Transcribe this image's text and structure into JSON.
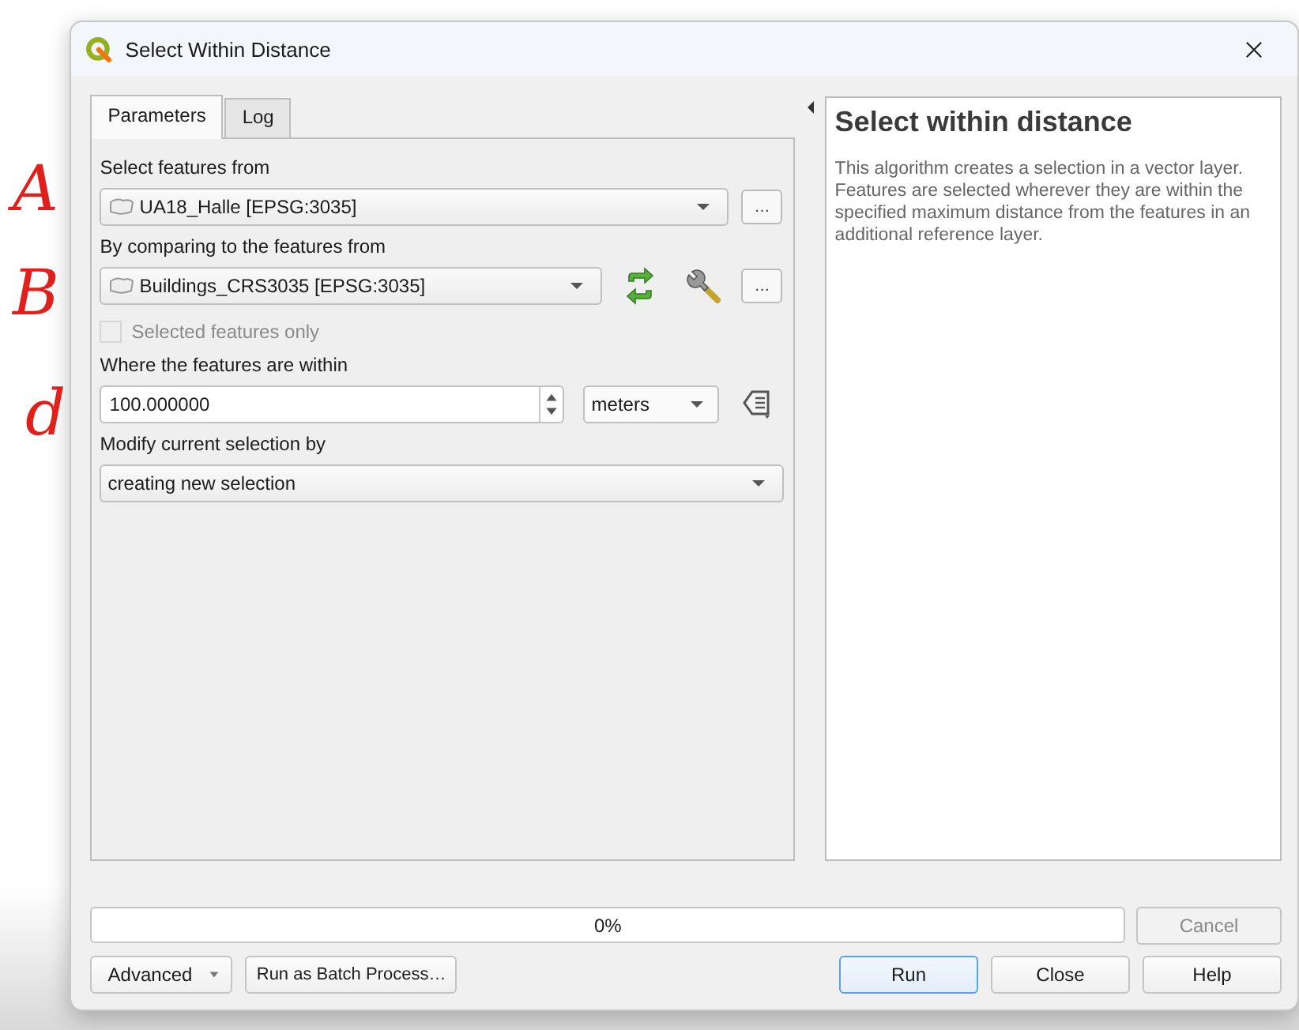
{
  "annotations": [
    {
      "text": "A"
    },
    {
      "text": "B"
    },
    {
      "text": "d"
    }
  ],
  "window": {
    "title": "Select Within Distance"
  },
  "tabs": [
    {
      "label": "Parameters",
      "selected": true
    },
    {
      "label": "Log",
      "selected": false
    }
  ],
  "fields": [
    {
      "kind": "layer",
      "label": "Select features from",
      "value": "UA18_Halle [EPSG:3035]",
      "browse": "…"
    },
    {
      "kind": "layer_tools",
      "label": "By comparing to the features from",
      "value": "Buildings_CRS3035 [EPSG:3035]",
      "browse": "…"
    },
    {
      "kind": "checkbox",
      "label": "Selected features only",
      "checked": false,
      "disabled": true
    },
    {
      "kind": "distance",
      "label": "Where the features are within",
      "value": "100.000000",
      "unit": "meters"
    },
    {
      "kind": "combo",
      "label": "Modify current selection by",
      "value": "creating new selection"
    }
  ],
  "help": {
    "title": "Select within distance",
    "text": "This algorithm creates a selection in a vector layer. Features are selected wherever they are within the specified maximum distance from the features in an additional reference layer."
  },
  "progress": {
    "level": 0,
    "reading": "0%"
  },
  "cancel": {
    "label": "Cancel",
    "disabled": true
  },
  "left_buttons": [
    {
      "kind": "menu",
      "label": "Advanced"
    },
    {
      "kind": "plain",
      "label": "Run as Batch Process…"
    }
  ],
  "right_buttons": [
    {
      "label": "Run",
      "default": true
    },
    {
      "label": "Close",
      "default": false
    },
    {
      "label": "Help",
      "default": false
    }
  ]
}
